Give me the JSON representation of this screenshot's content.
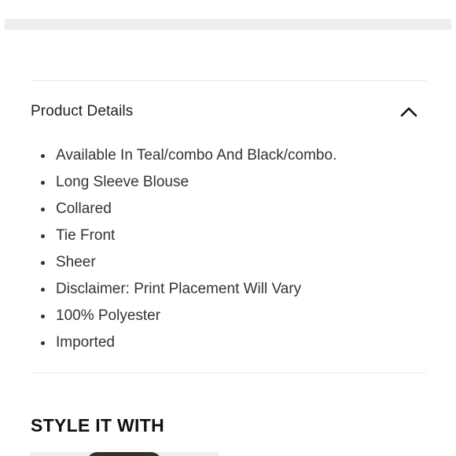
{
  "product_details": {
    "title": "Product Details",
    "toggle_icon": "chevron-up-icon",
    "items": [
      "Available In Teal/combo And Black/combo.",
      "Long Sleeve Blouse",
      "Collared",
      "Tie Front",
      "Sheer",
      "Disclaimer: Print Placement Will Vary",
      "100% Polyester",
      "Imported"
    ]
  },
  "style_it_with": {
    "heading": "STYLE IT WITH"
  },
  "colors": {
    "text": "#333333",
    "heading": "#111111",
    "divider": "#e6e6e6",
    "top_bar": "#eeeeee"
  }
}
